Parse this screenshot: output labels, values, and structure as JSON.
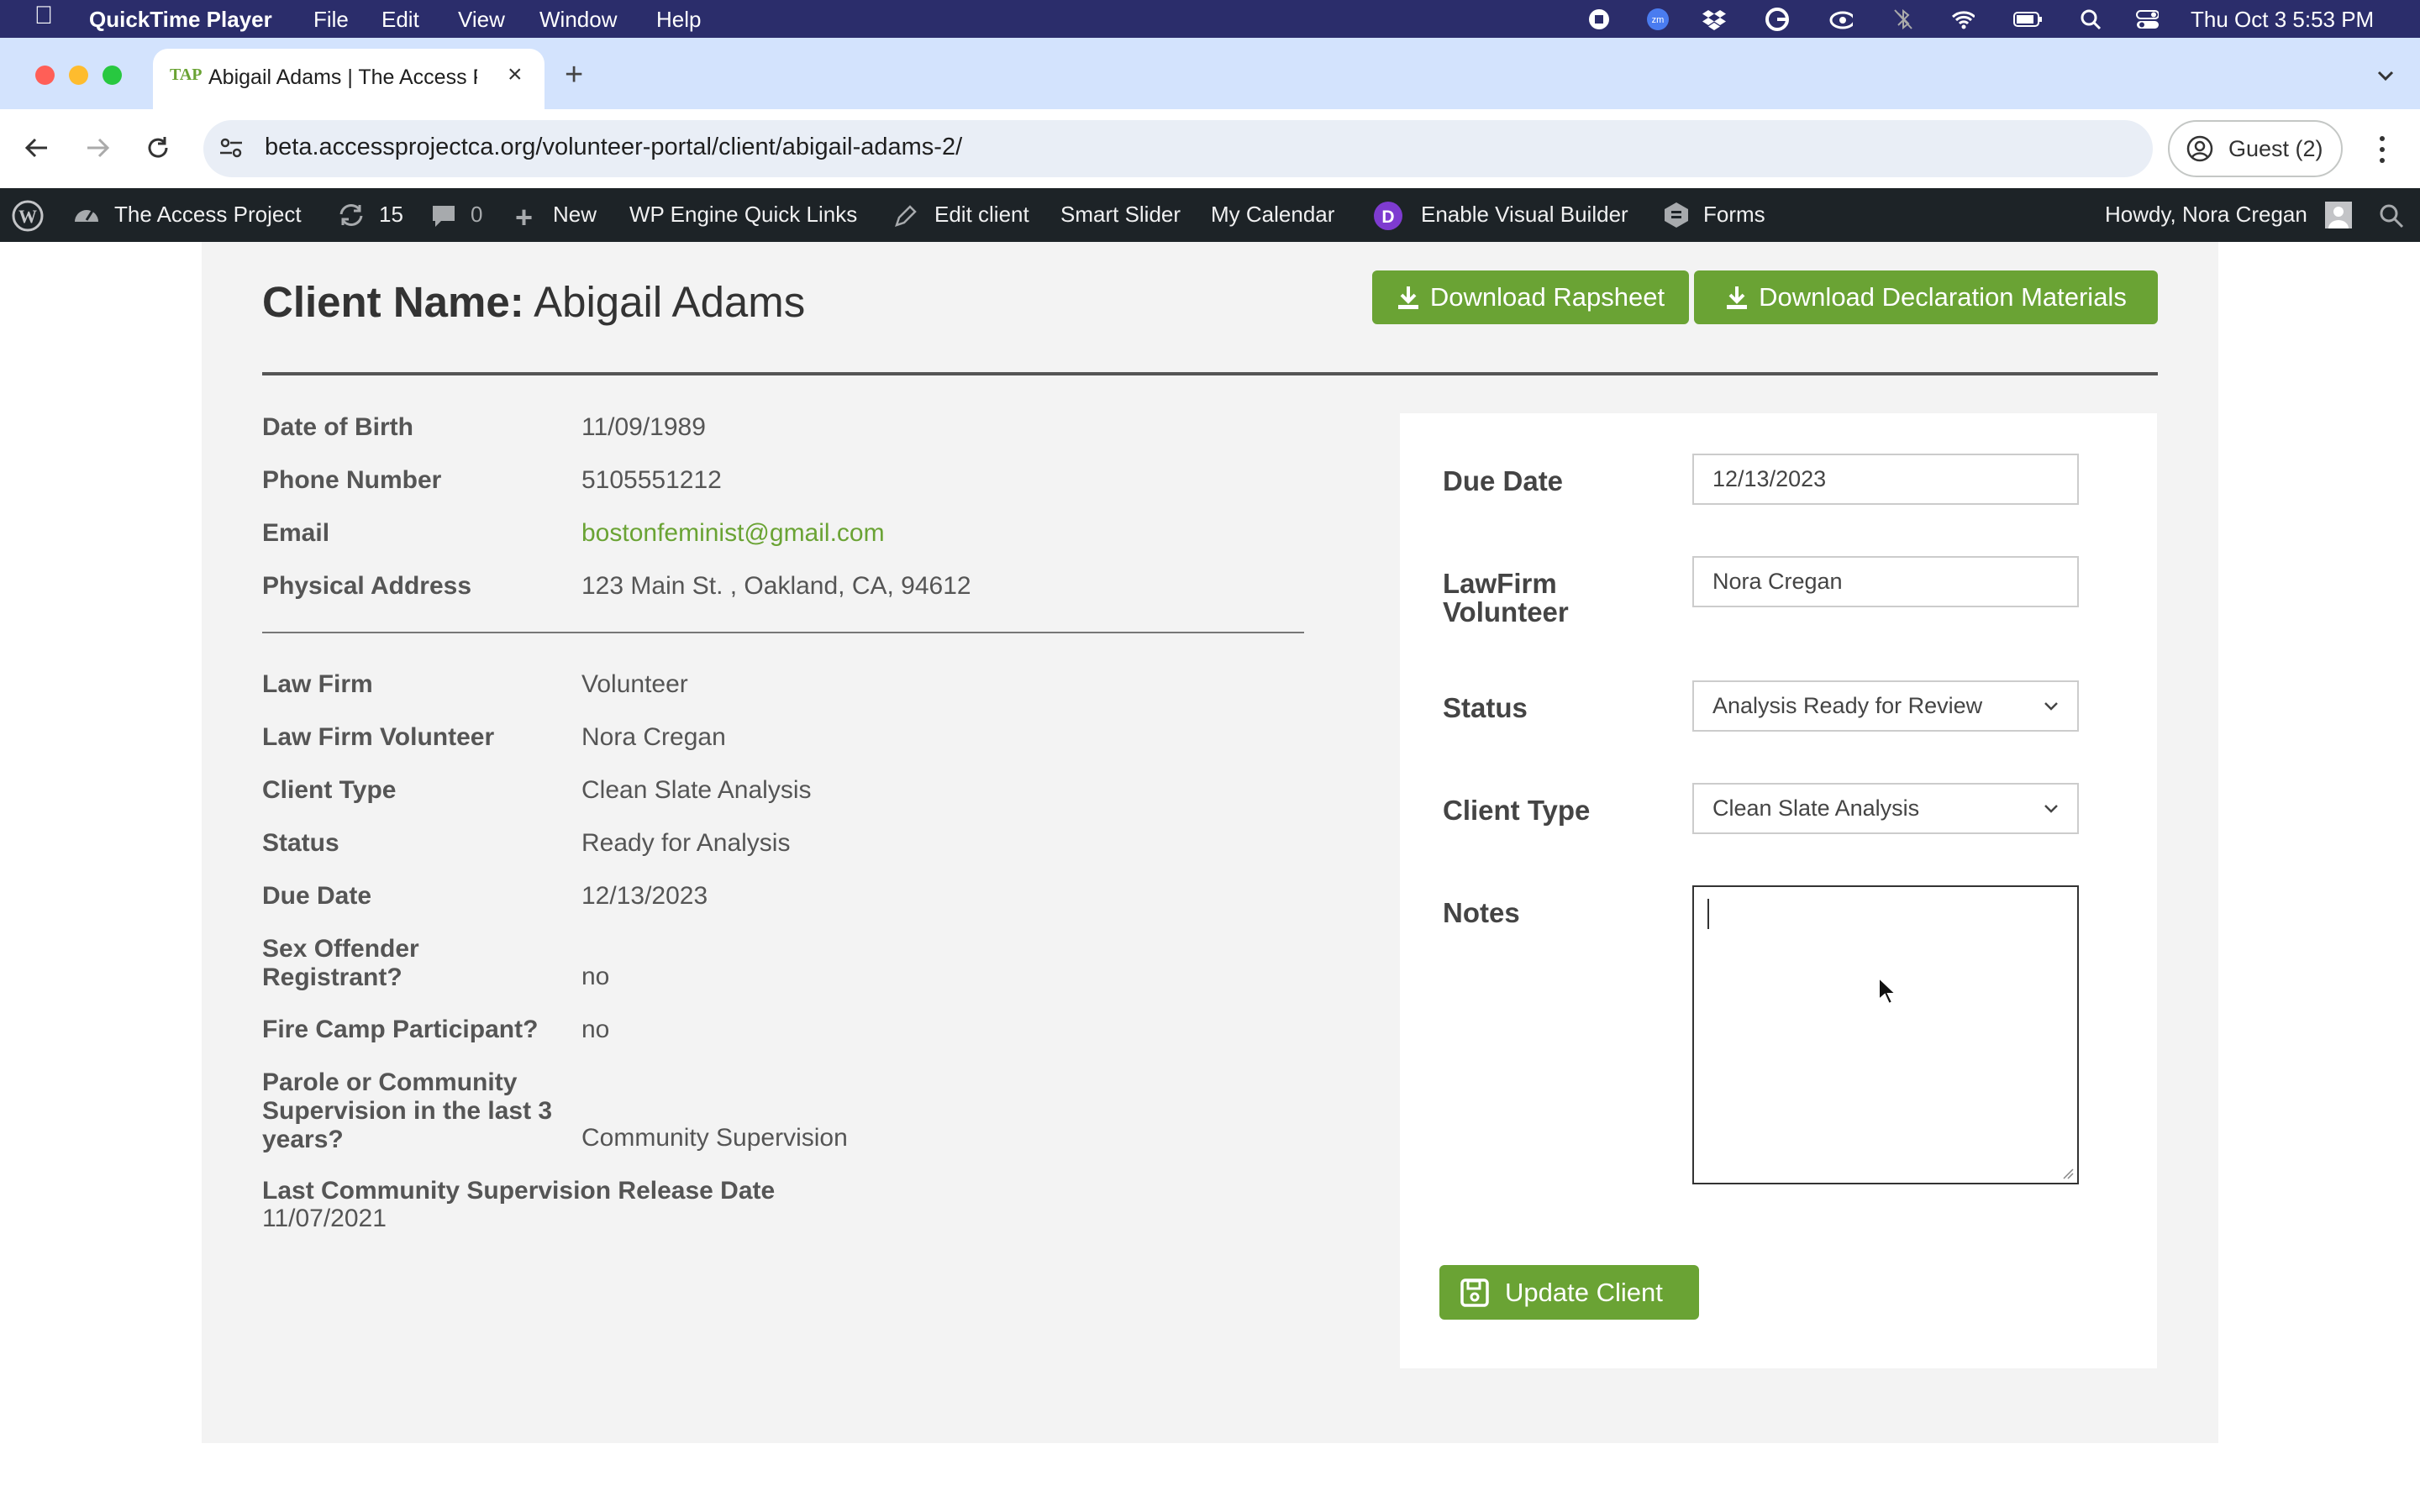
{
  "menubar": {
    "app": "QuickTime Player",
    "items": [
      "File",
      "Edit",
      "View",
      "Window",
      "Help"
    ],
    "clock": "Thu Oct 3  5:53 PM"
  },
  "browser": {
    "tab_title": "Abigail Adams | The Access P",
    "tab_icon": "TAP",
    "url": "beta.accessprojectca.org/volunteer-portal/client/abigail-adams-2/",
    "guest_label": "Guest (2)"
  },
  "wpbar": {
    "site": "The Access Project",
    "updates": "15",
    "comments": "0",
    "new": "New",
    "quick_links": "WP Engine Quick Links",
    "edit": "Edit client",
    "slider": "Smart Slider",
    "calendar": "My Calendar",
    "visual": "Enable Visual Builder",
    "forms": "Forms",
    "howdy": "Howdy, Nora Cregan"
  },
  "client": {
    "title_label": "Client Name:",
    "name": "Abigail Adams",
    "download_rapsheet": "Download Rapsheet",
    "download_declaration": "Download Declaration Materials",
    "details": [
      {
        "label": "Date of Birth",
        "value": "11/09/1989"
      },
      {
        "label": "Phone Number",
        "value": "5105551212"
      },
      {
        "label": "Email",
        "value": "bostonfeminist@gmail.com"
      },
      {
        "label": "Physical Address",
        "value": "123 Main St. , Oakland, CA, 94612"
      }
    ],
    "case": [
      {
        "label": "Law Firm",
        "value": "Volunteer"
      },
      {
        "label": "Law Firm Volunteer",
        "value": "Nora Cregan"
      },
      {
        "label": "Client Type",
        "value": "Clean Slate Analysis"
      },
      {
        "label": "Status",
        "value": "Ready for Analysis"
      },
      {
        "label": "Due Date",
        "value": "12/13/2023"
      },
      {
        "label": "Sex Offender Registrant?",
        "value": "no"
      },
      {
        "label": "Fire Camp Participant?",
        "value": "no"
      },
      {
        "label": "Parole or Community Supervision in the last 3 years?",
        "value": "Community Supervision"
      },
      {
        "label": "Last Community Supervision Release Date",
        "value": "11/07/2021"
      }
    ]
  },
  "form": {
    "due_date_label": "Due Date",
    "due_date": "12/13/2023",
    "volunteer_label": "LawFirm Volunteer",
    "volunteer": "Nora Cregan",
    "status_label": "Status",
    "status": "Analysis Ready for Review",
    "client_type_label": "Client Type",
    "client_type": "Clean Slate Analysis",
    "notes_label": "Notes",
    "notes": "",
    "update_button": "Update Client"
  },
  "colors": {
    "accent_green": "#6aa334",
    "email_link": "#6aa334",
    "menubar": "#2b2d6b",
    "wpbar": "#1d2327"
  }
}
